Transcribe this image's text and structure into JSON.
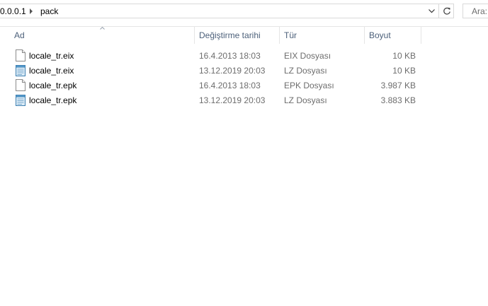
{
  "address": {
    "path_parts": [
      "0.0.0.1",
      "pack"
    ]
  },
  "search": {
    "placeholder": "Ara:"
  },
  "columns": {
    "name": "Ad",
    "date": "Değiştirme tarihi",
    "type": "Tür",
    "size": "Boyut"
  },
  "files": [
    {
      "name": "locale_tr.eix",
      "date": "16.4.2013 18:03",
      "type": "EIX Dosyası",
      "size": "10 KB",
      "icon": "blank-file-icon"
    },
    {
      "name": "locale_tr.eix",
      "date": "13.12.2019 20:03",
      "type": "LZ Dosyası",
      "size": "10 KB",
      "icon": "notepad-file-icon"
    },
    {
      "name": "locale_tr.epk",
      "date": "16.4.2013 18:03",
      "type": "EPK Dosyası",
      "size": "3.987 KB",
      "icon": "blank-file-icon"
    },
    {
      "name": "locale_tr.epk",
      "date": "13.12.2019 20:03",
      "type": "LZ Dosyası",
      "size": "3.883 KB",
      "icon": "notepad-file-icon"
    }
  ],
  "colors": {
    "header_text": "#4c607a",
    "secondary_text": "#6d6d6d",
    "border": "#d9d9d9"
  }
}
